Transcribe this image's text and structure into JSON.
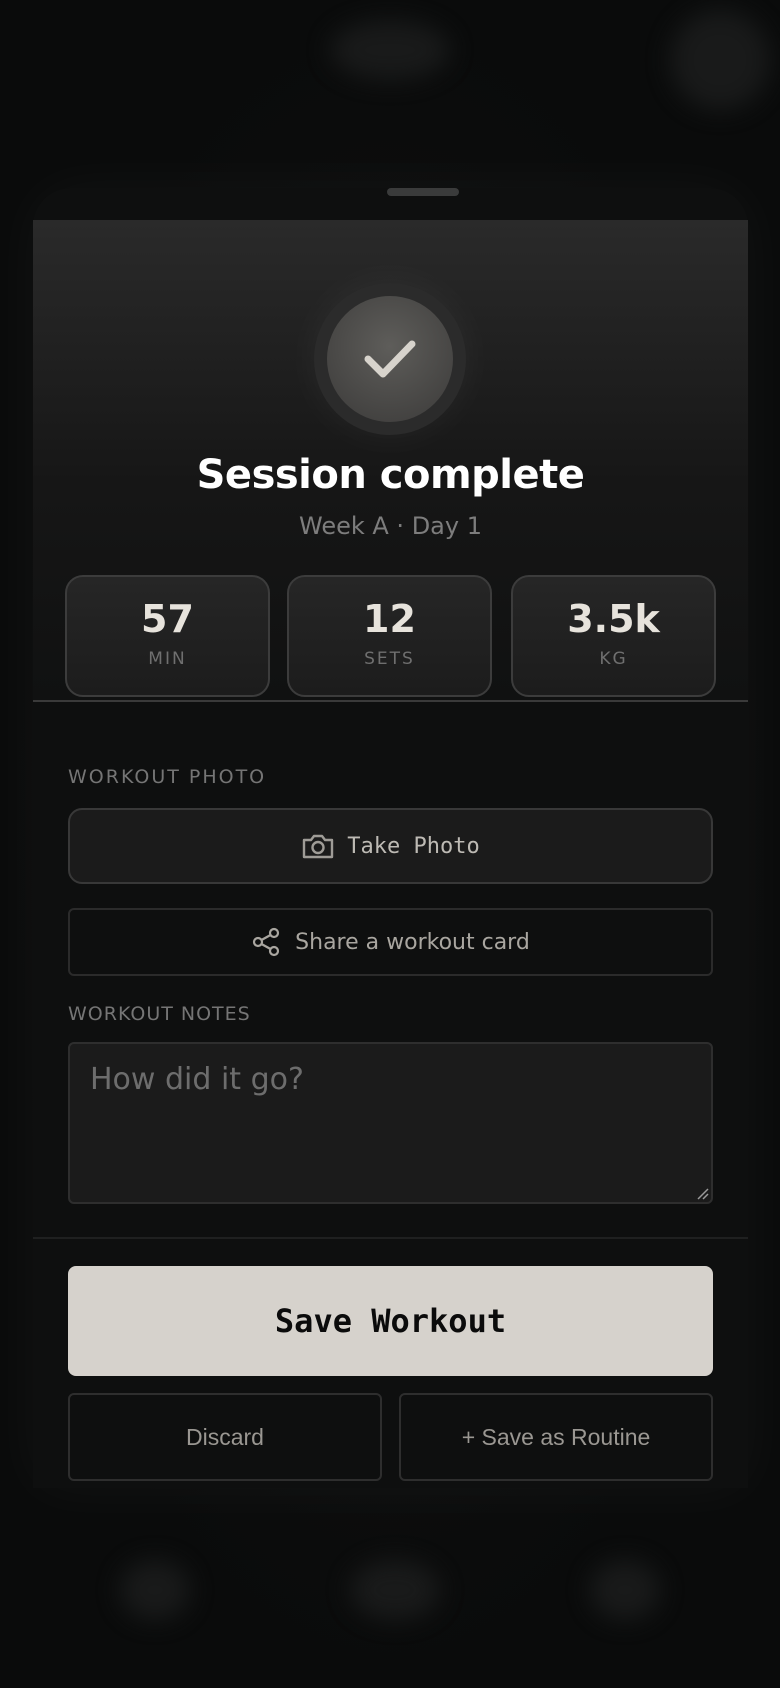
{
  "summary": {
    "title": "Session complete",
    "subtitle": "Week A · Day 1",
    "stats": [
      {
        "value": "57",
        "unit": "MIN"
      },
      {
        "value": "12",
        "unit": "SETS"
      },
      {
        "value": "3.5k",
        "unit": "KG"
      }
    ]
  },
  "photo": {
    "section_label": "WORKOUT PHOTO",
    "take_photo_label": "Take Photo",
    "share_label": "Share a workout card"
  },
  "notes": {
    "section_label": "WORKOUT NOTES",
    "placeholder": "How did it go?"
  },
  "actions": {
    "save_label": "Save Workout",
    "discard_label": "Discard",
    "save_routine_label": "+ Save as Routine"
  },
  "icons": {
    "check": "check-icon",
    "camera": "camera-icon",
    "share": "share-icon",
    "resize": "resize-grip-icon"
  },
  "colors": {
    "primary_button": "#d6d2cc",
    "background": "#0e0f0f"
  }
}
